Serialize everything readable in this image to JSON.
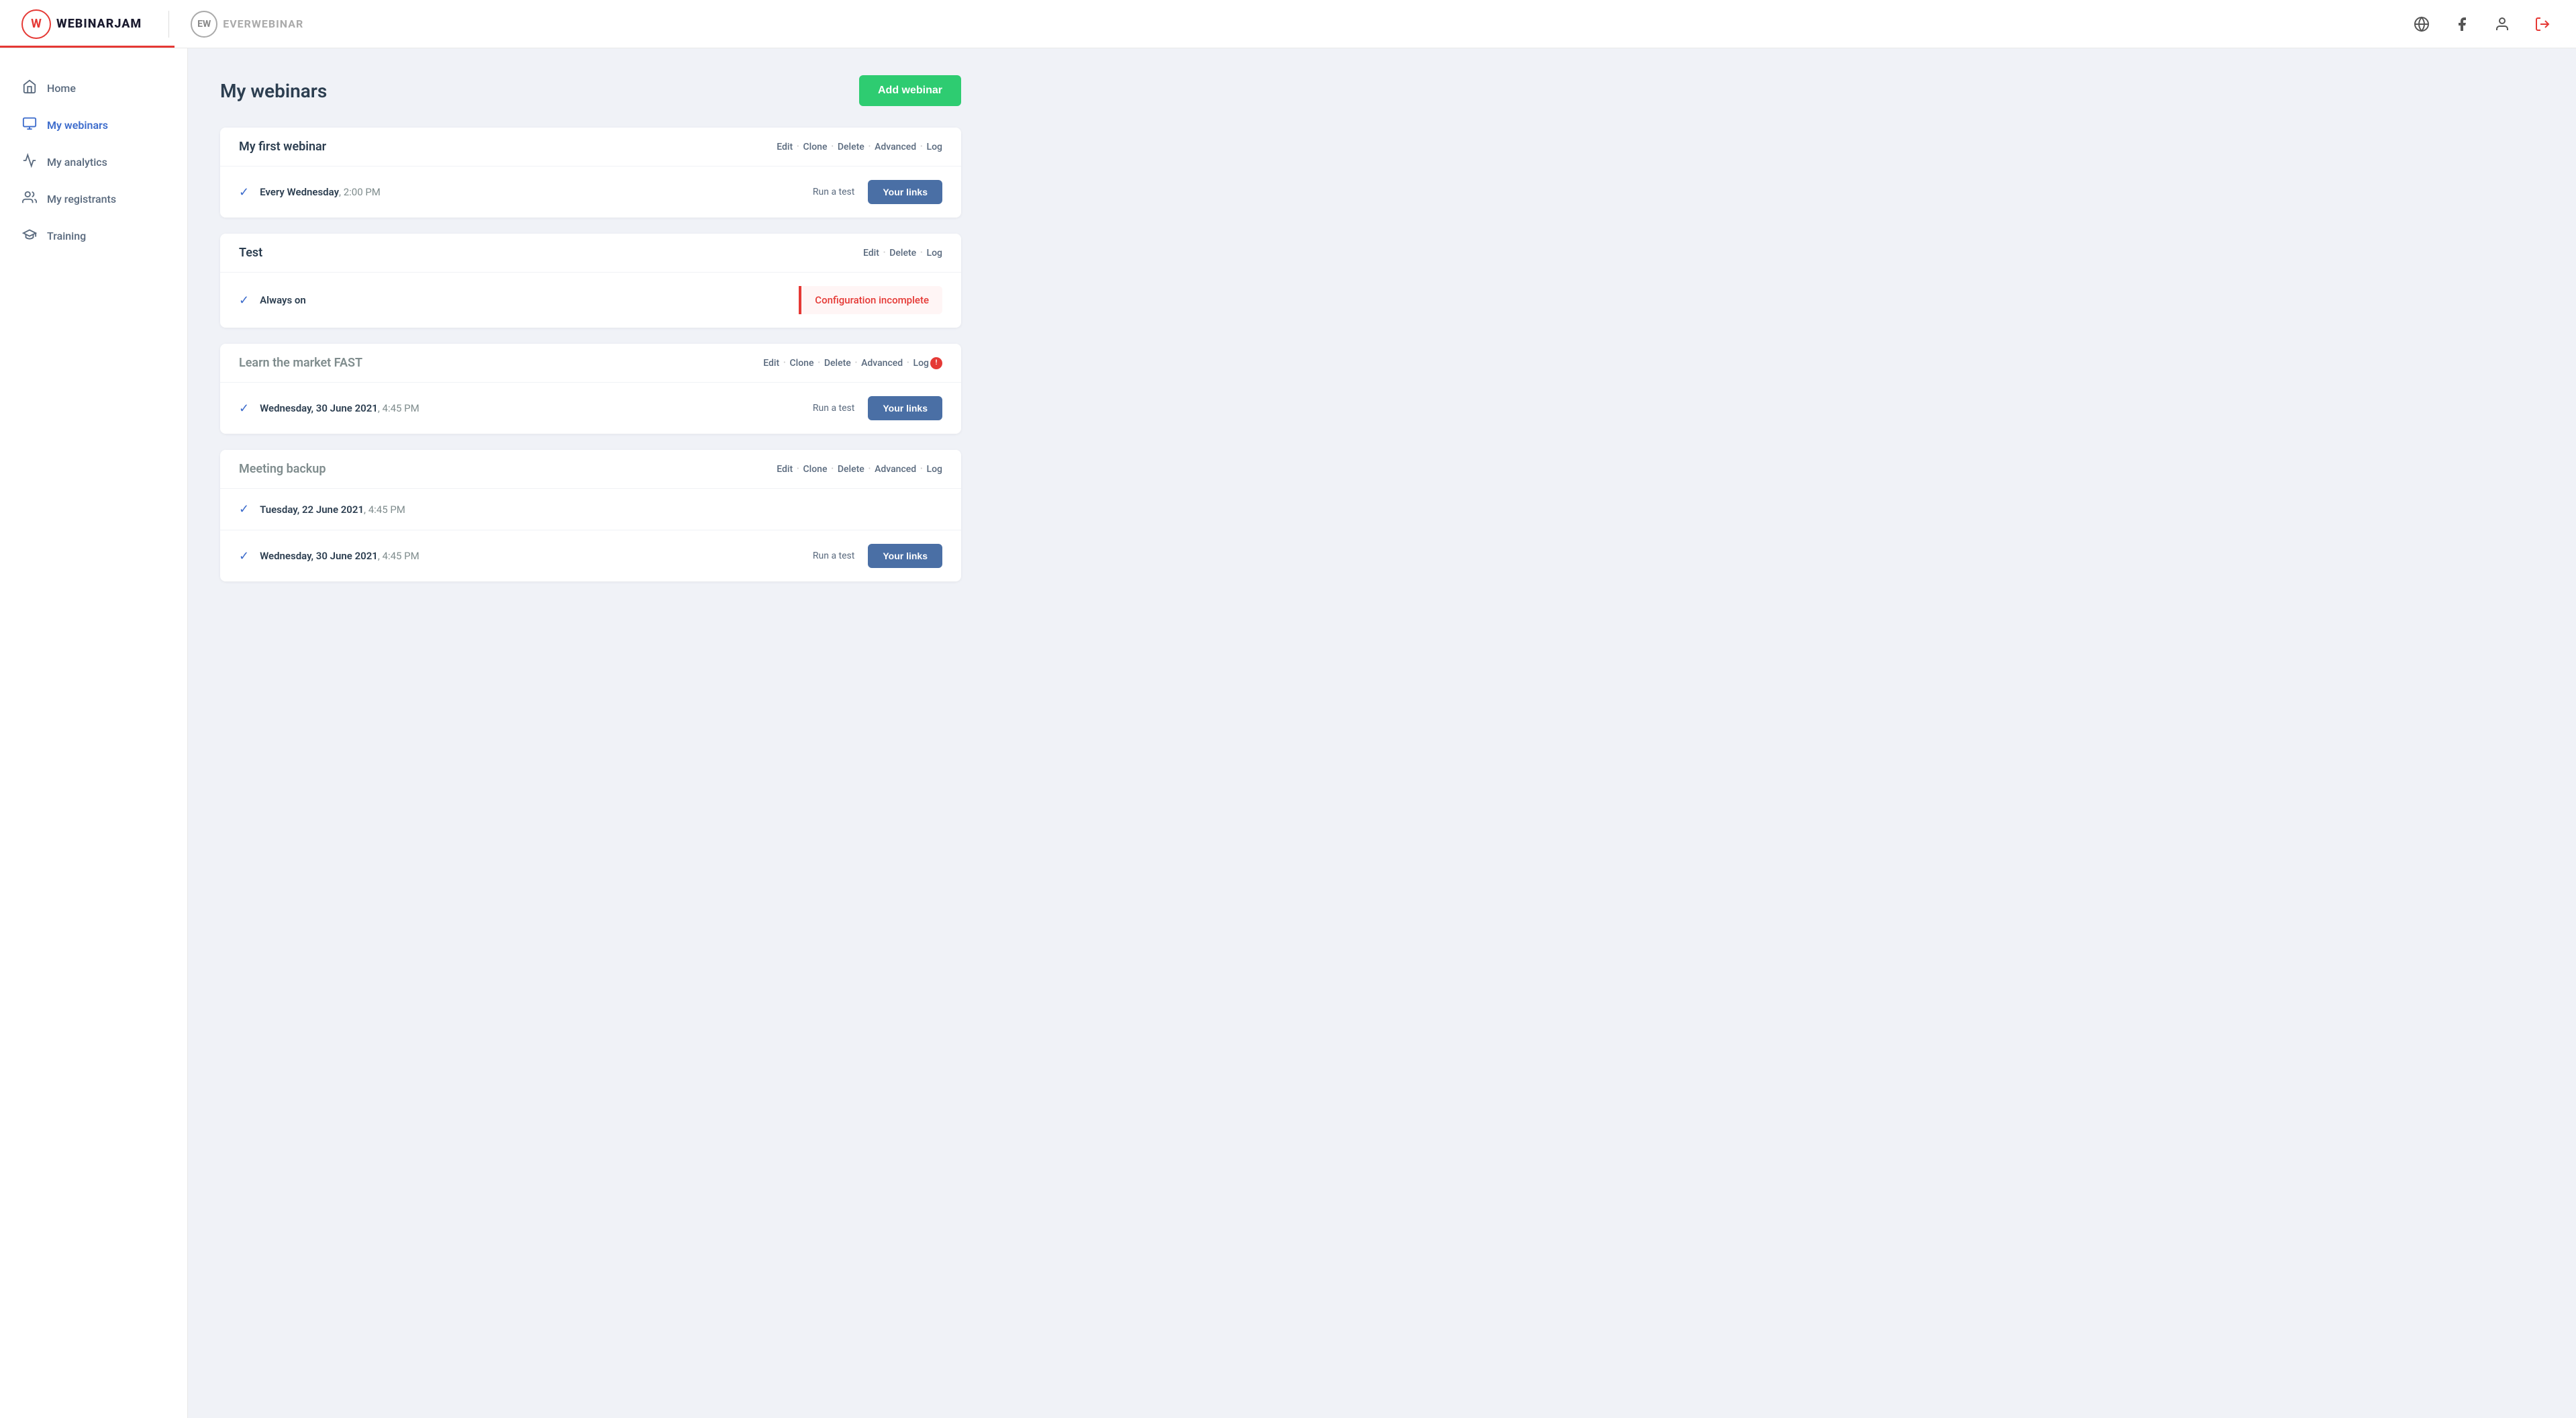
{
  "header": {
    "logo_wj_letter": "W",
    "logo_wj_text": "WEBINARJAM",
    "logo_ew_letter": "EW",
    "logo_ew_text": "EVERWEBINAR",
    "icons": {
      "globe": "🌐",
      "facebook": "f",
      "user": "👤",
      "logout": "⎋"
    }
  },
  "sidebar": {
    "items": [
      {
        "id": "home",
        "label": "Home",
        "icon": "🏠",
        "active": false
      },
      {
        "id": "my-webinars",
        "label": "My webinars",
        "icon": "🖥",
        "active": true
      },
      {
        "id": "my-analytics",
        "label": "My analytics",
        "icon": "📈",
        "active": false
      },
      {
        "id": "my-registrants",
        "label": "My registrants",
        "icon": "👥",
        "active": false
      },
      {
        "id": "training",
        "label": "Training",
        "icon": "🎓",
        "active": false
      }
    ]
  },
  "main": {
    "page_title": "My webinars",
    "add_webinar_label": "Add webinar",
    "webinars": [
      {
        "id": "first-webinar",
        "title": "My first webinar",
        "title_muted": false,
        "actions": [
          "Edit",
          "Clone",
          "Delete",
          "Advanced",
          "Log"
        ],
        "sessions": [
          {
            "schedule_bold": "Every Wednesday",
            "schedule_rest": ", 2:00 PM",
            "show_run_test": true,
            "run_test_label": "Run a test",
            "show_your_links": true,
            "your_links_label": "Your links",
            "config_incomplete": false
          }
        ]
      },
      {
        "id": "test",
        "title": "Test",
        "title_muted": false,
        "actions": [
          "Edit",
          "Delete",
          "Log"
        ],
        "sessions": [
          {
            "schedule_bold": "Always on",
            "schedule_rest": "",
            "show_run_test": false,
            "run_test_label": "",
            "show_your_links": false,
            "your_links_label": "",
            "config_incomplete": true,
            "config_incomplete_text": "Configuration incomplete"
          }
        ]
      },
      {
        "id": "learn-market",
        "title": "Learn the market FAST",
        "title_muted": true,
        "actions": [
          "Edit",
          "Clone",
          "Delete",
          "Advanced",
          "Log"
        ],
        "has_notification": true,
        "notification_count": "!",
        "sessions": [
          {
            "schedule_bold": "Wednesday, 30 June 2021",
            "schedule_rest": ", 4:45 PM",
            "show_run_test": true,
            "run_test_label": "Run a test",
            "show_your_links": true,
            "your_links_label": "Your links",
            "config_incomplete": false
          }
        ]
      },
      {
        "id": "meeting-backup",
        "title": "Meeting backup",
        "title_muted": true,
        "actions": [
          "Edit",
          "Clone",
          "Delete",
          "Advanced",
          "Log"
        ],
        "sessions": [
          {
            "schedule_bold": "Tuesday, 22 June 2021",
            "schedule_rest": ", 4:45 PM",
            "show_run_test": false,
            "run_test_label": "",
            "show_your_links": false,
            "your_links_label": "",
            "config_incomplete": false
          },
          {
            "schedule_bold": "Wednesday, 30 June 2021",
            "schedule_rest": ", 4:45 PM",
            "show_run_test": true,
            "run_test_label": "Run a test",
            "show_your_links": true,
            "your_links_label": "Your links",
            "config_incomplete": false
          }
        ]
      }
    ]
  }
}
